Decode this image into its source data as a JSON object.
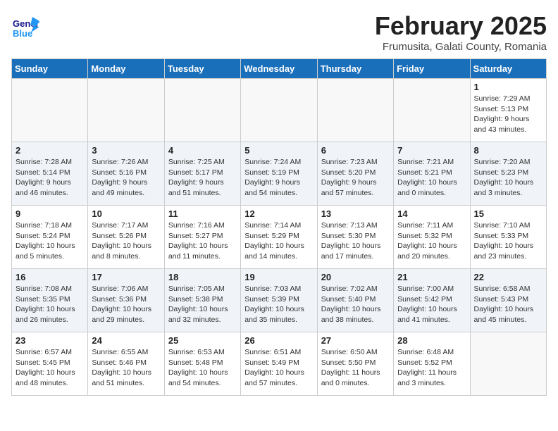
{
  "header": {
    "logo_text_general": "General",
    "logo_text_blue": "Blue",
    "month_title": "February 2025",
    "subtitle": "Frumusita, Galati County, Romania"
  },
  "days_of_week": [
    "Sunday",
    "Monday",
    "Tuesday",
    "Wednesday",
    "Thursday",
    "Friday",
    "Saturday"
  ],
  "weeks": [
    [
      {
        "day": "",
        "info": ""
      },
      {
        "day": "",
        "info": ""
      },
      {
        "day": "",
        "info": ""
      },
      {
        "day": "",
        "info": ""
      },
      {
        "day": "",
        "info": ""
      },
      {
        "day": "",
        "info": ""
      },
      {
        "day": "1",
        "info": "Sunrise: 7:29 AM\nSunset: 5:13 PM\nDaylight: 9 hours\nand 43 minutes."
      }
    ],
    [
      {
        "day": "2",
        "info": "Sunrise: 7:28 AM\nSunset: 5:14 PM\nDaylight: 9 hours\nand 46 minutes."
      },
      {
        "day": "3",
        "info": "Sunrise: 7:26 AM\nSunset: 5:16 PM\nDaylight: 9 hours\nand 49 minutes."
      },
      {
        "day": "4",
        "info": "Sunrise: 7:25 AM\nSunset: 5:17 PM\nDaylight: 9 hours\nand 51 minutes."
      },
      {
        "day": "5",
        "info": "Sunrise: 7:24 AM\nSunset: 5:19 PM\nDaylight: 9 hours\nand 54 minutes."
      },
      {
        "day": "6",
        "info": "Sunrise: 7:23 AM\nSunset: 5:20 PM\nDaylight: 9 hours\nand 57 minutes."
      },
      {
        "day": "7",
        "info": "Sunrise: 7:21 AM\nSunset: 5:21 PM\nDaylight: 10 hours\nand 0 minutes."
      },
      {
        "day": "8",
        "info": "Sunrise: 7:20 AM\nSunset: 5:23 PM\nDaylight: 10 hours\nand 3 minutes."
      }
    ],
    [
      {
        "day": "9",
        "info": "Sunrise: 7:18 AM\nSunset: 5:24 PM\nDaylight: 10 hours\nand 5 minutes."
      },
      {
        "day": "10",
        "info": "Sunrise: 7:17 AM\nSunset: 5:26 PM\nDaylight: 10 hours\nand 8 minutes."
      },
      {
        "day": "11",
        "info": "Sunrise: 7:16 AM\nSunset: 5:27 PM\nDaylight: 10 hours\nand 11 minutes."
      },
      {
        "day": "12",
        "info": "Sunrise: 7:14 AM\nSunset: 5:29 PM\nDaylight: 10 hours\nand 14 minutes."
      },
      {
        "day": "13",
        "info": "Sunrise: 7:13 AM\nSunset: 5:30 PM\nDaylight: 10 hours\nand 17 minutes."
      },
      {
        "day": "14",
        "info": "Sunrise: 7:11 AM\nSunset: 5:32 PM\nDaylight: 10 hours\nand 20 minutes."
      },
      {
        "day": "15",
        "info": "Sunrise: 7:10 AM\nSunset: 5:33 PM\nDaylight: 10 hours\nand 23 minutes."
      }
    ],
    [
      {
        "day": "16",
        "info": "Sunrise: 7:08 AM\nSunset: 5:35 PM\nDaylight: 10 hours\nand 26 minutes."
      },
      {
        "day": "17",
        "info": "Sunrise: 7:06 AM\nSunset: 5:36 PM\nDaylight: 10 hours\nand 29 minutes."
      },
      {
        "day": "18",
        "info": "Sunrise: 7:05 AM\nSunset: 5:38 PM\nDaylight: 10 hours\nand 32 minutes."
      },
      {
        "day": "19",
        "info": "Sunrise: 7:03 AM\nSunset: 5:39 PM\nDaylight: 10 hours\nand 35 minutes."
      },
      {
        "day": "20",
        "info": "Sunrise: 7:02 AM\nSunset: 5:40 PM\nDaylight: 10 hours\nand 38 minutes."
      },
      {
        "day": "21",
        "info": "Sunrise: 7:00 AM\nSunset: 5:42 PM\nDaylight: 10 hours\nand 41 minutes."
      },
      {
        "day": "22",
        "info": "Sunrise: 6:58 AM\nSunset: 5:43 PM\nDaylight: 10 hours\nand 45 minutes."
      }
    ],
    [
      {
        "day": "23",
        "info": "Sunrise: 6:57 AM\nSunset: 5:45 PM\nDaylight: 10 hours\nand 48 minutes."
      },
      {
        "day": "24",
        "info": "Sunrise: 6:55 AM\nSunset: 5:46 PM\nDaylight: 10 hours\nand 51 minutes."
      },
      {
        "day": "25",
        "info": "Sunrise: 6:53 AM\nSunset: 5:48 PM\nDaylight: 10 hours\nand 54 minutes."
      },
      {
        "day": "26",
        "info": "Sunrise: 6:51 AM\nSunset: 5:49 PM\nDaylight: 10 hours\nand 57 minutes."
      },
      {
        "day": "27",
        "info": "Sunrise: 6:50 AM\nSunset: 5:50 PM\nDaylight: 11 hours\nand 0 minutes."
      },
      {
        "day": "28",
        "info": "Sunrise: 6:48 AM\nSunset: 5:52 PM\nDaylight: 11 hours\nand 3 minutes."
      },
      {
        "day": "",
        "info": ""
      }
    ]
  ]
}
